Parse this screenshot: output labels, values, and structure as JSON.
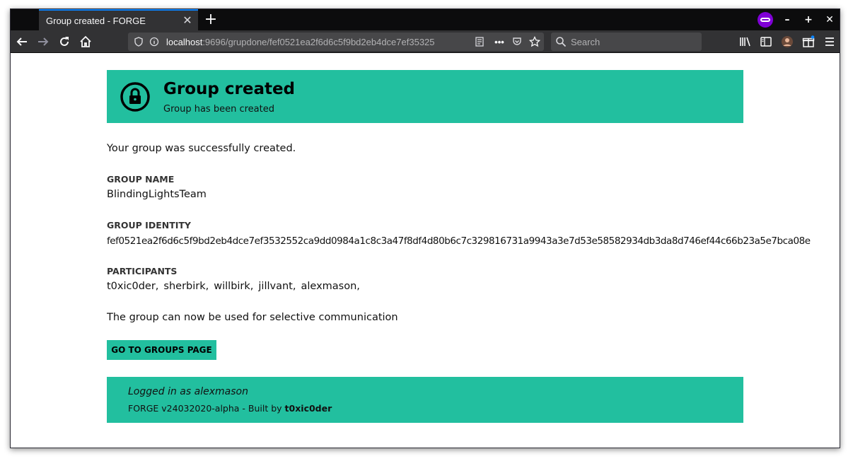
{
  "browser": {
    "tab_title": "Group created - FORGE",
    "url_host": "localhost",
    "url_rest": ":9696/grupdone/fef0521ea2f6d6c5f9bd2eb4dce7ef35325",
    "search_placeholder": "Search"
  },
  "banner": {
    "title": "Group created",
    "subtitle": "Group has been created",
    "icon": "lock-icon"
  },
  "main": {
    "success_message": "Your group was successfully created.",
    "group_name_label": "GROUP NAME",
    "group_name": "BlindingLightsTeam",
    "group_identity_label": "GROUP IDENTITY",
    "group_identity": "fef0521ea2f6d6c5f9bd2eb4dce7ef3532552ca9dd0984a1c8c3a47f8df4d80b6c7c329816731a9943a3e7d53e58582934db3da8d746ef44c66b23a5e7bca08e",
    "participants_label": "PARTICIPANTS",
    "participants": [
      "t0xic0der,",
      "sherbirk,",
      "willbirk,",
      "jillvant,",
      "alexmason,"
    ],
    "usage_message": "The group can now be used for selective communication",
    "groups_button": "GO TO GROUPS PAGE"
  },
  "footer": {
    "login_text": "Logged in as alexmason",
    "build_text": "FORGE v24032020-alpha - Built by",
    "author": "t0xic0der"
  },
  "colors": {
    "accent": "#22bf9f",
    "private_badge": "#8000d7"
  }
}
